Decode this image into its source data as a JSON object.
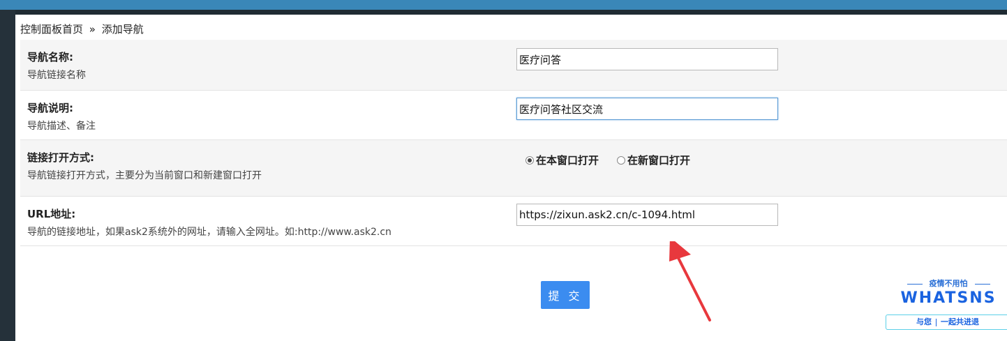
{
  "breadcrumb": {
    "home": "控制面板首页",
    "separator": "»",
    "current": "添加导航"
  },
  "form": {
    "nav_name": {
      "title": "导航名称:",
      "desc": "导航链接名称",
      "value": "医疗问答"
    },
    "nav_desc": {
      "title": "导航说明:",
      "desc": "导航描述、备注",
      "value": "医疗问答社区交流"
    },
    "open_mode": {
      "title": "链接打开方式:",
      "desc": "导航链接打开方式，主要分为当前窗口和新建窗口打开",
      "options": [
        {
          "label": "在本窗口打开",
          "checked": true
        },
        {
          "label": "在新窗口打开",
          "checked": false
        }
      ]
    },
    "url": {
      "title": "URL地址:",
      "desc": "导航的链接地址，如果ask2系统外的网址，请输入全网址。如:http://www.ask2.cn",
      "value": "https://zixun.ask2.cn/c-1094.html"
    },
    "submit_label": "提 交"
  },
  "watermark": {
    "tagline": "疫情不用怕",
    "brand": "WHATSNS",
    "slogan_left": "与您",
    "slogan_right": "一起共进退"
  },
  "colors": {
    "accent": "#3b8cf0",
    "topbar": "#3a87b8",
    "sidebar": "#25313a",
    "annotation_arrow": "#e8383d"
  }
}
